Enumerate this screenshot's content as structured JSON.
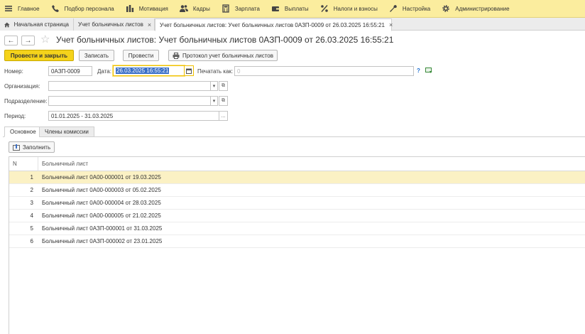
{
  "menu": [
    {
      "label": "Главное",
      "icon": "menu-icon"
    },
    {
      "label": "Подбор персонала",
      "icon": "phone-icon"
    },
    {
      "label": "Мотивация",
      "icon": "chart-icon"
    },
    {
      "label": "Кадры",
      "icon": "people-icon"
    },
    {
      "label": "Зарплата",
      "icon": "calculator-icon"
    },
    {
      "label": "Выплаты",
      "icon": "wallet-icon"
    },
    {
      "label": "Налоги и взносы",
      "icon": "percent-icon"
    },
    {
      "label": "Настройка",
      "icon": "wrench-icon"
    },
    {
      "label": "Администрирование",
      "icon": "gear-icon"
    }
  ],
  "tabs": [
    {
      "label": "Начальная страница"
    },
    {
      "label": "Учет больничных листов",
      "close": "×"
    },
    {
      "label": "Учет больничных листов: Учет больничных листов 0АЗП-0009 от 26.03.2025 16:55:21",
      "close": "×"
    }
  ],
  "nav": {
    "back": "←",
    "forward": "→",
    "star": "☆"
  },
  "title": "Учет больничных листов: Учет больничных листов 0АЗП-0009 от 26.03.2025 16:55:21",
  "toolbar": {
    "post_close": "Провести и закрыть",
    "save": "Записать",
    "post": "Провести",
    "print_protocol": "Протокол учет больничных листов"
  },
  "form": {
    "number_label": "Номер:",
    "number_value": "0АЗП-0009",
    "date_label": "Дата:",
    "date_value": "26.03.2025 16:55:21",
    "print_as_label": "Печатать как:",
    "print_as_placeholder": "0",
    "help": "?",
    "organization_label": "Организация:",
    "organization_value": "",
    "department_label": "Подразделение:",
    "department_value": "",
    "period_label": "Период:",
    "period_value": "01.01.2025 - 31.03.2025",
    "period_button": "..."
  },
  "inner_tabs": [
    {
      "label": "Основное"
    },
    {
      "label": "Члены комиссии"
    }
  ],
  "fill_button": "Заполнить",
  "table": {
    "columns": [
      "N",
      "Больничный лист"
    ],
    "rows": [
      {
        "n": "1",
        "doc": "Больничный лист 0А00-000001 от 19.03.2025"
      },
      {
        "n": "2",
        "doc": "Больничный лист 0А00-000003 от 05.02.2025"
      },
      {
        "n": "3",
        "doc": "Больничный лист 0А00-000004 от 28.03.2025"
      },
      {
        "n": "4",
        "doc": "Больничный лист 0А00-000005 от 21.02.2025"
      },
      {
        "n": "5",
        "doc": "Больничный лист 0АЗП-000001 от 31.03.2025"
      },
      {
        "n": "6",
        "doc": "Больничный лист 0АЗП-000002 от 23.01.2025"
      }
    ]
  },
  "colors": {
    "menu_bg": "#fbed9e",
    "primary_button": "#f5d31b",
    "selected_row": "#fbf1c4",
    "help_blue": "#1f6fd0"
  }
}
